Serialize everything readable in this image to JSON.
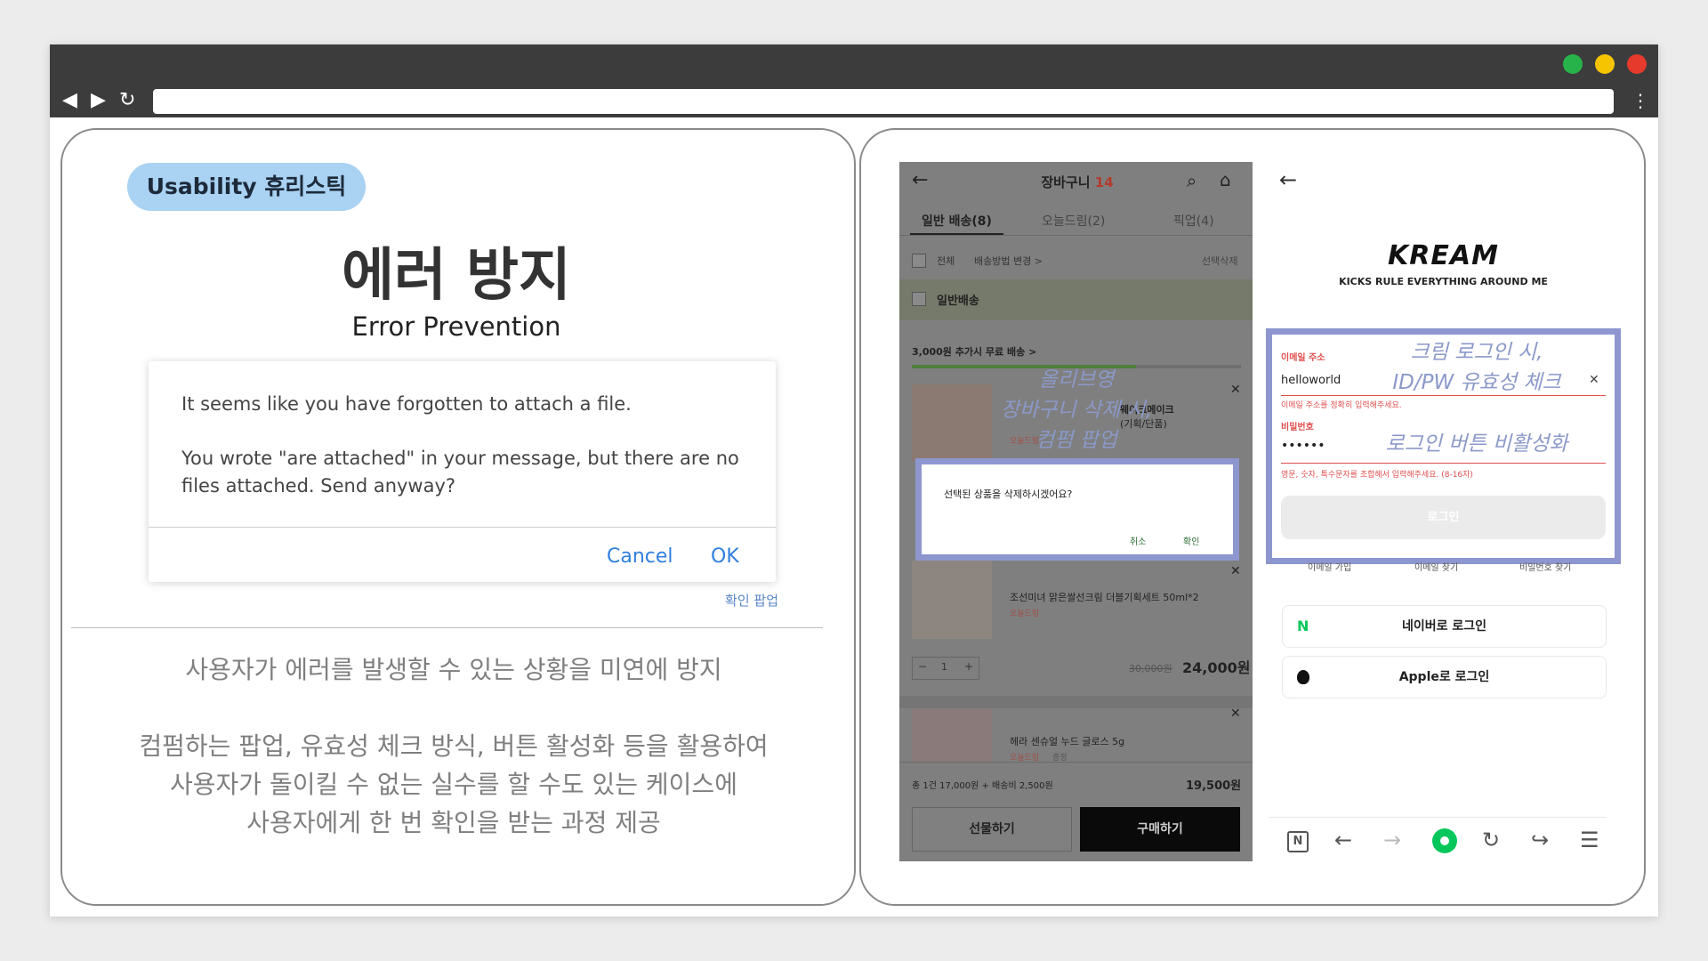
{
  "left_panel": {
    "badge": "Usability 휴리스틱",
    "title_ko": "에러 방지",
    "title_en": "Error Prevention",
    "dialog": {
      "line1": "It seems like you have forgotten to attach a file.",
      "line2": "You wrote \"are attached\" in your message, but there are no",
      "line3": "files attached. Send anyway?",
      "cancel": "Cancel",
      "ok": "OK"
    },
    "caption": "확인 팝업",
    "desc1": "사용자가 에러를 발생할 수 있는 상황을 미연에 방지",
    "desc2": "컴펌하는 팝업, 유효성 체크 방식, 버튼 활성화 등을 활용하여",
    "desc3": "사용자가 돌이킬 수 없는 실수를 할 수도 있는 케이스에",
    "desc4": "사용자에게 한 번 확인을 받는 과정 제공"
  },
  "oliveyoung": {
    "header_title": "장바구니",
    "header_count": "14",
    "tabs": [
      "일반 배송(8)",
      "오늘드림(2)",
      "픽업(4)"
    ],
    "select_all": "전체",
    "change_method": "배송방법 변경 >",
    "delete_selected": "선택삭제",
    "section": "일반배송",
    "free_ship": "3,000원 추가시 무료 배송 >",
    "item1_name": "웨이크메이크",
    "item1_sub": "(기획/단품)",
    "item1_tag": "오늘드림",
    "popup_text": "선택된 상품을 삭제하시겠어요?",
    "popup_cancel": "취소",
    "popup_ok": "확인",
    "item2_name": "조선미녀 맑은쌀선크림 더블기획세트 50ml*2",
    "item2_tag": "오늘드림",
    "qty": "1",
    "old_price": "30,000원",
    "price": "24,000원",
    "item3_name": "헤라 센슈얼 누드 글로스 5g",
    "item3_tag": "오늘드림",
    "item3_tag2": "증정",
    "total_label": "총 1건 17,000원 + 배송비 2,500원",
    "total": "19,500원",
    "gift_btn": "선물하기",
    "buy_btn": "구매하기",
    "annotation1": "올리브영",
    "annotation2": "장바구니 삭제 시,",
    "annotation3": "컴펌 팝업"
  },
  "kream": {
    "logo": "KREAM",
    "slogan": "KICKS RULE EVERYTHING AROUND ME",
    "email_label": "이메일 주소",
    "email_value": "helloworld",
    "email_error": "이메일 주소를 정확히 입력해주세요.",
    "pw_label": "비밀번호",
    "pw_value": "••••••",
    "pw_error": "영문, 숫자, 특수문자를 조합해서 입력해주세요. (8-16자)",
    "login_btn": "로그인",
    "links": [
      "이메일 가입",
      "이메일 찾기",
      "비밀번호 찾기"
    ],
    "naver_btn": "네이버로 로그인",
    "naver_icon": "N",
    "apple_btn": "Apple로 로그인",
    "annotation1": "크림 로그인 시,",
    "annotation2": "ID/PW 유효성 체크",
    "annotation3": "로그인 버튼 비활성화",
    "naver_bar_icon": "N"
  }
}
